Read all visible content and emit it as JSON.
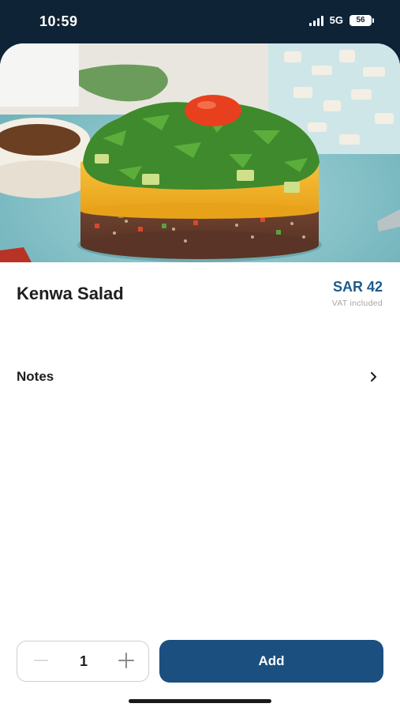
{
  "status_bar": {
    "time": "10:59",
    "network": "5G",
    "battery": "56"
  },
  "item": {
    "name": "Kenwa Salad",
    "price": "SAR 42",
    "vat_note": "VAT included"
  },
  "notes": {
    "label": "Notes",
    "icon": "chevron-right-icon"
  },
  "quantity": {
    "value": "1",
    "minus_icon": "minus-icon",
    "plus_icon": "plus-icon"
  },
  "actions": {
    "add_label": "Add"
  },
  "colors": {
    "status_bar_bg": "#0e2336",
    "price": "#1f5a8c",
    "primary_button": "#1b4f80",
    "text": "#1e1e1e",
    "muted_text": "#a5a5a5"
  }
}
